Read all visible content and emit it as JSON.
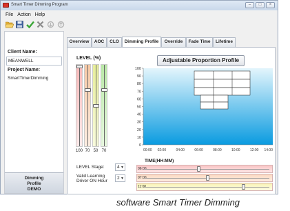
{
  "window": {
    "title": "Smart Timer Dimming Program"
  },
  "menu": {
    "items": [
      "File",
      "Action",
      "Help"
    ]
  },
  "toolbar": {
    "icons": [
      "open-folder-icon",
      "save-icon",
      "checkmark-icon",
      "delete-x-icon",
      "import-icon",
      "export-icon"
    ]
  },
  "sidebar": {
    "client_label": "Client Name:",
    "client_value": "MEANWELL",
    "project_label": "Project Name:",
    "project_value": "SmartTimerDimming",
    "nav_label_line1": "Dimming",
    "nav_label_line2": "Profile",
    "nav_label_line3": "DEMO"
  },
  "tabs": [
    {
      "label": "Overview",
      "active": false
    },
    {
      "label": "AOC",
      "active": false
    },
    {
      "label": "CLO",
      "active": false
    },
    {
      "label": "Dimming Profile",
      "active": true
    },
    {
      "label": "Override",
      "active": false
    },
    {
      "label": "Fade Time",
      "active": false
    },
    {
      "label": "Lifetime",
      "active": false
    }
  ],
  "level_panel": {
    "title": "LEVEL (%)",
    "levels": [
      {
        "label": "100",
        "value": 100
      },
      {
        "label": "70",
        "value": 70
      },
      {
        "label": "50",
        "value": 50
      },
      {
        "label": "70",
        "value": 70
      }
    ],
    "level_stage_label": "LEVEL Stage:",
    "level_stage_value": "4",
    "valid_learning_label_1": "Valid Learning",
    "valid_learning_label_2": "Driver ON Hour",
    "valid_learning_value": "2"
  },
  "profile_button": {
    "label": "Adjustable Proportion Profile"
  },
  "chart_data": {
    "type": "area",
    "y_ticks": [
      "0",
      "10",
      "20",
      "30",
      "40",
      "50",
      "60",
      "70",
      "80",
      "90",
      "100"
    ],
    "x_ticks": [
      "00:00",
      "02:00",
      "04:00",
      "06:00",
      "08:00",
      "10:00",
      "12:00",
      "14:00"
    ],
    "xlabel": "TIME(HH:MM)",
    "ylim": [
      0,
      100
    ],
    "xlim_hours": [
      0,
      14
    ]
  },
  "time_rows": [
    {
      "label": "06:00",
      "position": 0.43
    },
    {
      "label": "07:00",
      "position": 0.5
    },
    {
      "label": "11:00",
      "position": 0.79
    }
  ],
  "caption": "software Smart Timer Dimming",
  "colors": {
    "accent_red": "#d9342b",
    "chart_top": "#e3f5fc",
    "chart_bottom": "#0a9be0"
  }
}
